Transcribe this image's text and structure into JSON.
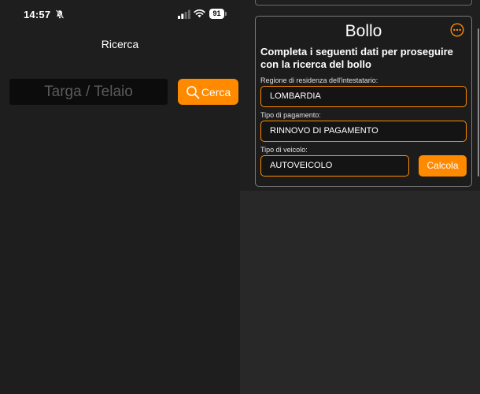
{
  "status_bar": {
    "time": "14:57",
    "battery": "91",
    "icons": [
      "bell-slash-icon",
      "cellular-signal-icon",
      "wifi-icon",
      "battery-icon"
    ]
  },
  "search_screen": {
    "title": "Ricerca",
    "input_placeholder": "Targa / Telaio",
    "input_value": "",
    "search_button_label": "Cerca",
    "search_icon": "magnifier-icon"
  },
  "bollo_card": {
    "title": "Bollo",
    "more_icon": "ellipsis-circle-icon",
    "intro": "Completa i seguenti dati per proseguire con la ricerca del bollo",
    "fields": [
      {
        "label": "Regione di residenza dell'intestatario:",
        "value": "LOMBARDIA"
      },
      {
        "label": "Tipo di pagamento:",
        "value": "RINNOVO DI PAGAMENTO"
      },
      {
        "label": "Tipo di veicolo:",
        "value": "AUTOVEICOLO"
      }
    ],
    "calculate_button_label": "Calcola"
  },
  "colors": {
    "accent": "#ff8a00",
    "background_dark": "#1e1e1e",
    "field_background": "#141414"
  }
}
